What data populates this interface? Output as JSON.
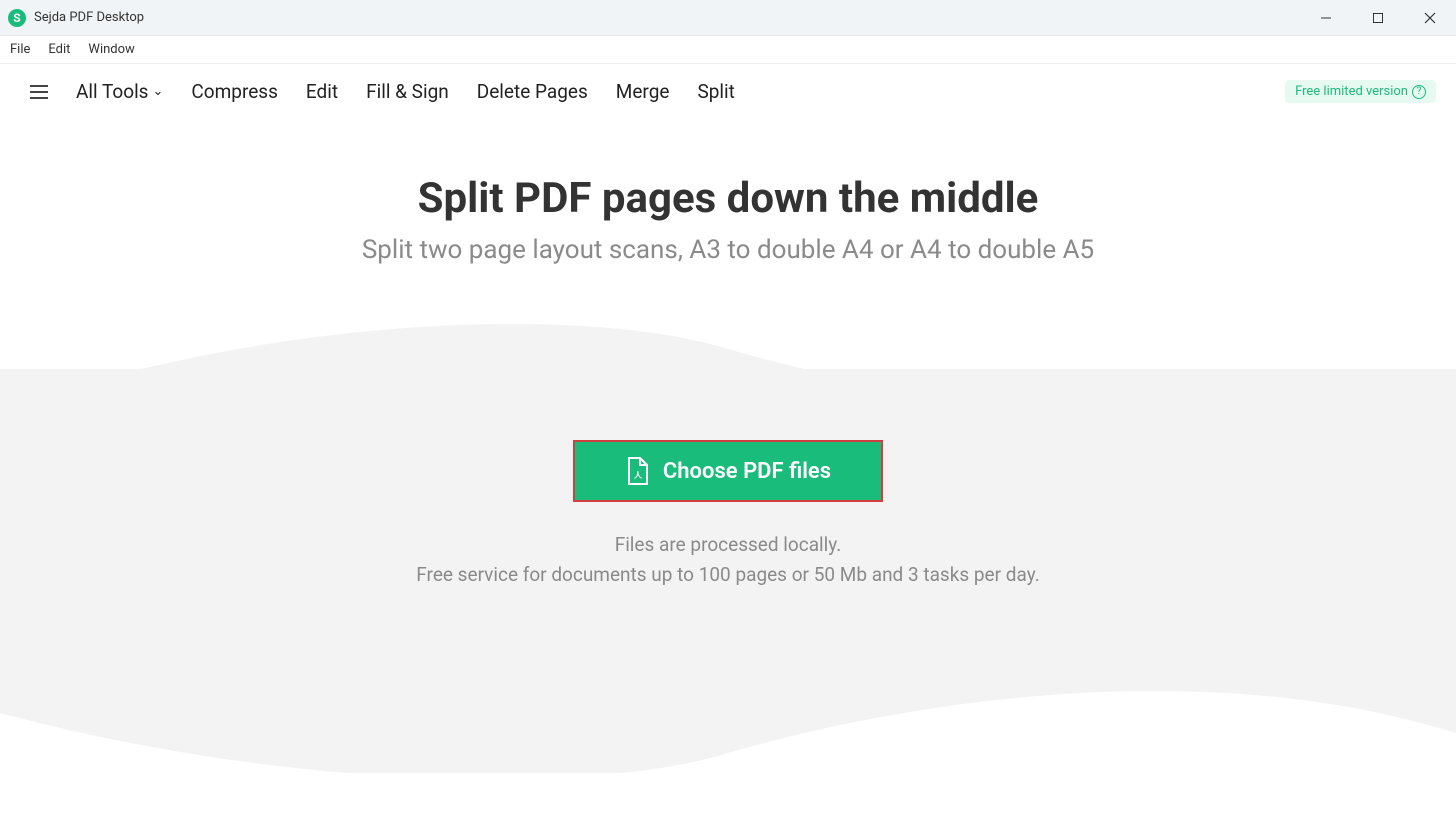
{
  "window": {
    "title": "Sejda PDF Desktop",
    "app_icon_letter": "S"
  },
  "menubar": {
    "items": [
      "File",
      "Edit",
      "Window"
    ]
  },
  "toolbar": {
    "all_tools": "All Tools",
    "links": [
      "Compress",
      "Edit",
      "Fill & Sign",
      "Delete Pages",
      "Merge",
      "Split"
    ],
    "version_label": "Free limited version"
  },
  "content": {
    "title": "Split PDF pages down the middle",
    "subtitle": "Split two page layout scans, A3 to double A4 or A4 to double A5",
    "choose_button": "Choose PDF files",
    "info_line1": "Files are processed locally.",
    "info_line2": "Free service for documents up to 100 pages or 50 Mb and 3 tasks per day."
  }
}
